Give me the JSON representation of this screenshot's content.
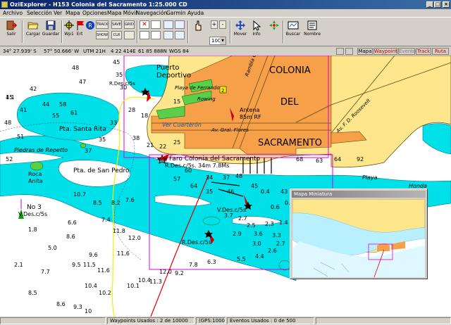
{
  "window": {
    "title": "OziExplorer - H153 Colonia del Sacramento 1:25.000 CD",
    "buttons": {
      "minimize": "_",
      "maximize": "□",
      "close": "×"
    }
  },
  "menu": [
    "Archivo",
    "Selección",
    "Ver",
    "Mapa",
    "Opciones",
    "Mapa Móvil",
    "Navegación",
    "Garmin",
    "Ayuda"
  ],
  "toolbar": {
    "exit": "Salir",
    "load": "Cargar",
    "save": "Guardar",
    "mini_wp": "Wp1",
    "mini_ert": "Ert",
    "mini_trk": "TRACK",
    "mini_show": "SHOW",
    "mini_save": "SAVE",
    "mini_clr": "CLR",
    "mini_grid": "GRID",
    "zoom_value": "100",
    "move": "Mover",
    "info": "Info",
    "search": "Buscar",
    "names": "Nombre"
  },
  "coords": {
    "lat": "34° 27.939' S",
    "lon": "57° 50.666' W",
    "utm_zone": "UTM 21H",
    "easting": "4 22 414E",
    "northing": "61 85 888N",
    "datum": "WGS 84"
  },
  "layer_tabs": [
    "Mapa",
    "Waypoint",
    "Evento",
    "Track",
    "Ruta"
  ],
  "map": {
    "town_name_1": "COLONIA",
    "town_name_2": "DEL",
    "town_name_3": "SACRAMENTO",
    "puerto_1": "Puerto",
    "puerto_2": "Deportivo",
    "playa_ferrando": "Playa de Ferrando",
    "rambla": "Rambla Costanera",
    "roosevelt": "Av. F. D. Roosevelt",
    "antena_1": "Antena",
    "antena_2": "85m RF",
    "ver_cuarteron": "Ver Cuarterón",
    "gral_flores": "Av. Gral. Flores",
    "faro": "Faro Colonia del Sacramento",
    "faro_light": "R.Des.c/5s. 34m 7.8Ms",
    "rdes_top": "R.Des.c/5s",
    "pta_santa_rita": "Pta. Santa Rita",
    "piedras_repetto": "Piedras de Repetto",
    "roca_anita_1": "Roca",
    "roca_anita_2": "Anita",
    "pta_san_pedro": "Pta. de San Pedro",
    "no3": "No 3",
    "vdes_left": "V.Des.c/5s",
    "vdes_mid": "V.Des.c/5s",
    "rdes_mid": "R.Des.c/5s",
    "playa": "Playa",
    "honda": "Honda",
    "rowing": "Rowing",
    "soundings": [
      "45",
      "42",
      "41",
      "44",
      "48",
      "47",
      "45",
      "35",
      "30",
      "28",
      "18",
      "15",
      "48",
      "51",
      "52",
      "55",
      "58",
      "61",
      "33",
      "35",
      "37",
      "38",
      "21",
      "22",
      "25",
      "60",
      "57",
      "64",
      "35",
      "34",
      "37",
      "48",
      "46",
      "45",
      "43",
      "68",
      "63",
      "64",
      "92",
      "10.7",
      "8.5",
      "8.2",
      "7.6",
      "7.4",
      "11.8",
      "12.0",
      "11.6",
      "9.6",
      "8.6",
      "9.5",
      "11.5",
      "11.6",
      "10.4",
      "10.2",
      "10.1",
      "10.4",
      "11.3",
      "12.0",
      "9.2",
      "7.8",
      "6.3",
      "5.5",
      "4.4",
      "2.7",
      "1.8",
      "5.0",
      "6.6",
      "7.7",
      "8.5",
      "8.6",
      "9.3",
      "10",
      "2.1",
      "3.7",
      "2.7",
      "2.5",
      "2.3",
      "0.6",
      "0.5",
      "0.4",
      "1.4",
      "2.9",
      "3.6",
      "3.3",
      "3.0",
      "2.6",
      "1.6",
      "1.9",
      "1.1"
    ],
    "route_start_label": "2"
  },
  "minimap": {
    "title": "Mapa Miniatura"
  },
  "status": {
    "waypoints": "Waypoints Usados : 2 de 10000",
    "gps": "(GPS:1000)",
    "events": "Eventos Usados : 0 de 500"
  },
  "colors": {
    "sea_deep": "#ffffff",
    "sea_shallow": "#00e0e8",
    "land": "#fde68c",
    "urban": "#f6a04a",
    "green": "#5ccf4a",
    "route": "#e00000",
    "track": "#f0f000",
    "frame": "#e000e0"
  }
}
